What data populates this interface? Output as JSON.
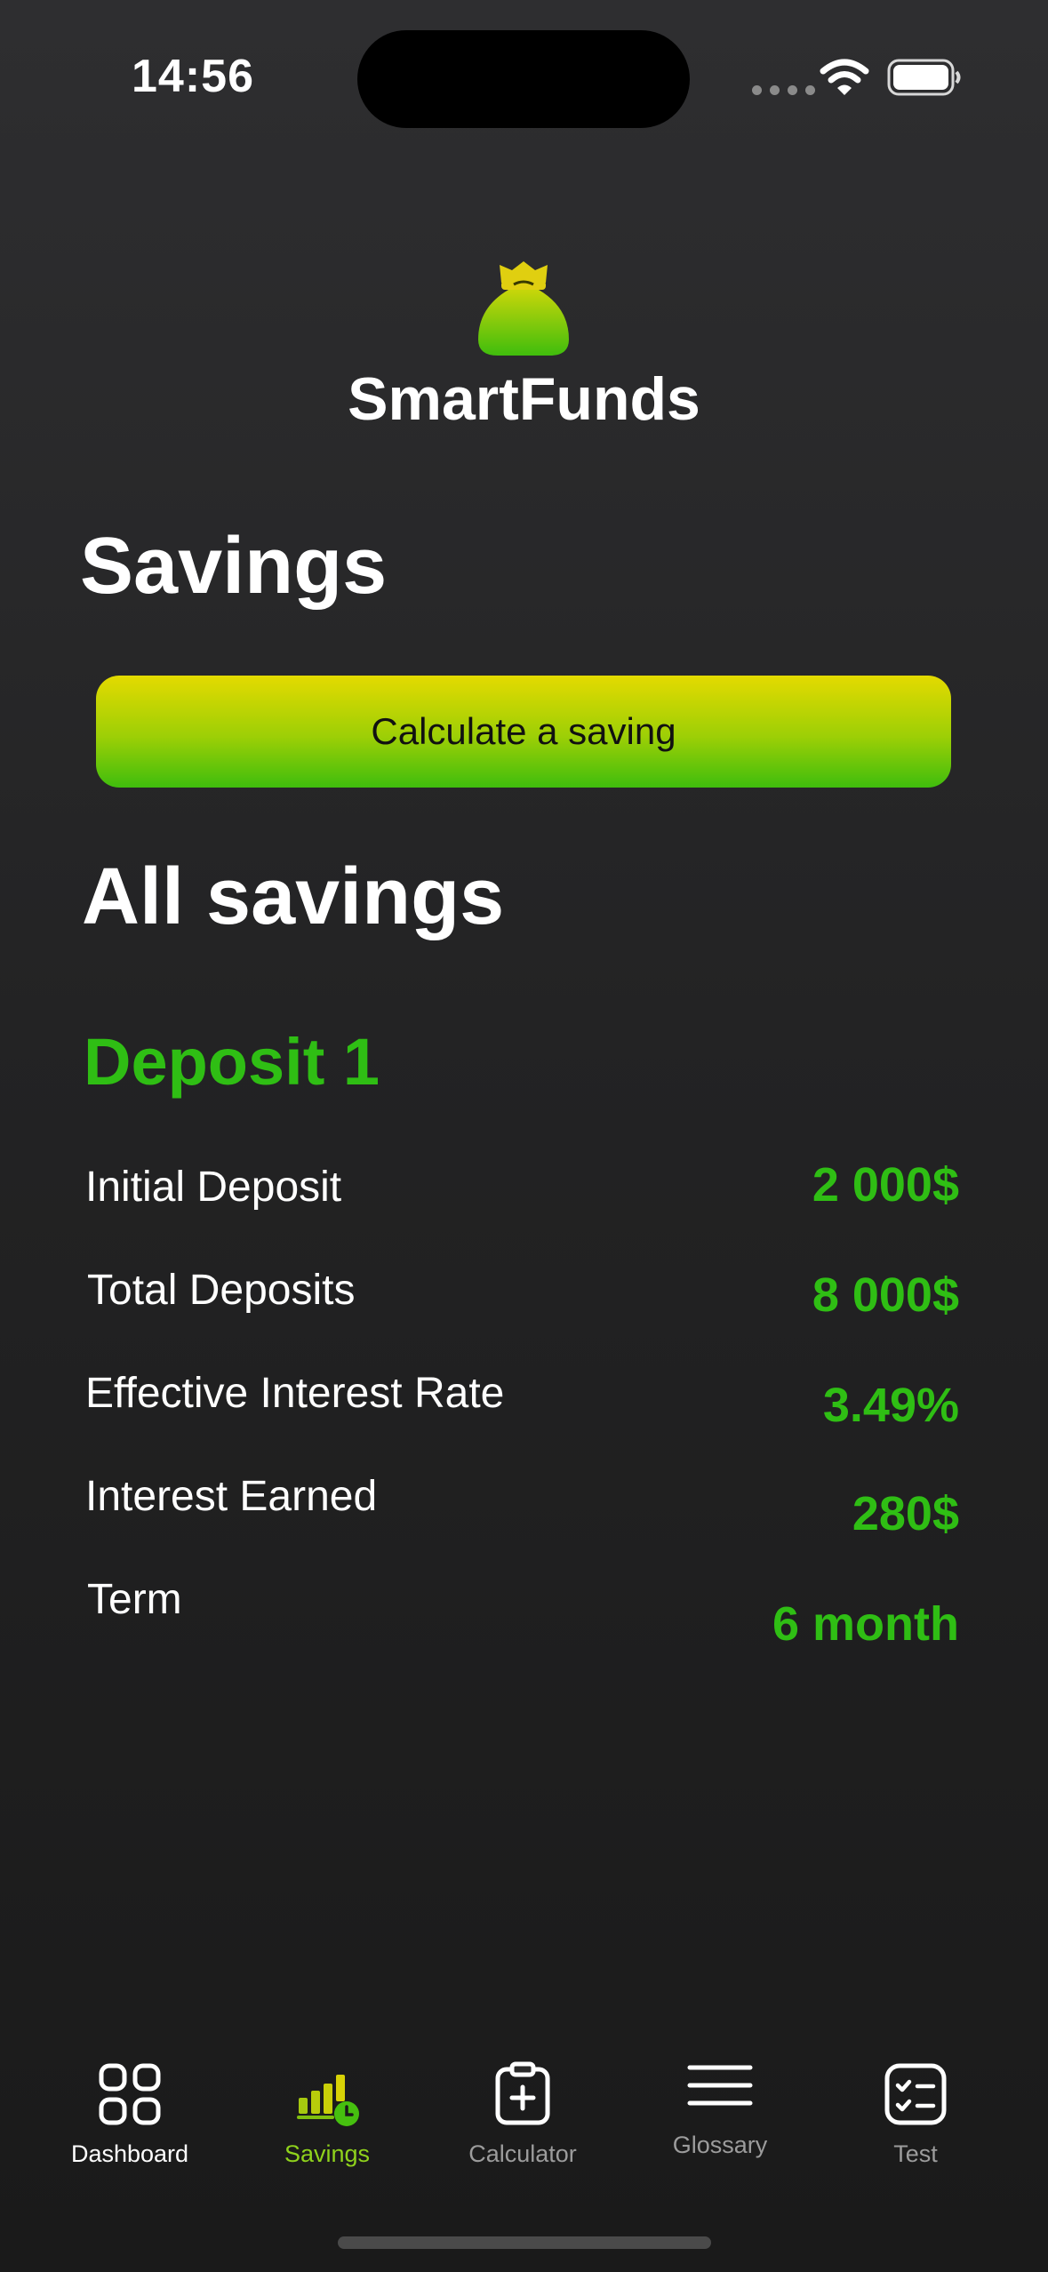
{
  "status_bar": {
    "time": "14:56"
  },
  "app": {
    "title": "SmartFunds"
  },
  "page": {
    "title": "Savings",
    "calculate_button": "Calculate a saving",
    "section_title": "All savings"
  },
  "deposit": {
    "title": "Deposit 1",
    "rows": [
      {
        "label": "Initial Deposit",
        "value": "2 000$"
      },
      {
        "label": "Total Deposits",
        "value": "8 000$"
      },
      {
        "label": "Effective Interest Rate",
        "value": "3.49%"
      },
      {
        "label": "Interest Earned",
        "value": "280$"
      },
      {
        "label": "Term",
        "value": "6 month"
      }
    ]
  },
  "tab_bar": {
    "active": "Savings",
    "items": [
      {
        "label": "Dashboard",
        "icon": "grid-icon"
      },
      {
        "label": "Savings",
        "icon": "savings-chart-icon"
      },
      {
        "label": "Calculator",
        "icon": "clipboard-plus-icon"
      },
      {
        "label": "Glossary",
        "icon": "menu-lines-icon"
      },
      {
        "label": "Test",
        "icon": "checklist-icon"
      }
    ]
  },
  "colors": {
    "accent_green": "#2fbe14",
    "accent_yellow": "#e4da00",
    "tab_active": "#8fd21c"
  }
}
